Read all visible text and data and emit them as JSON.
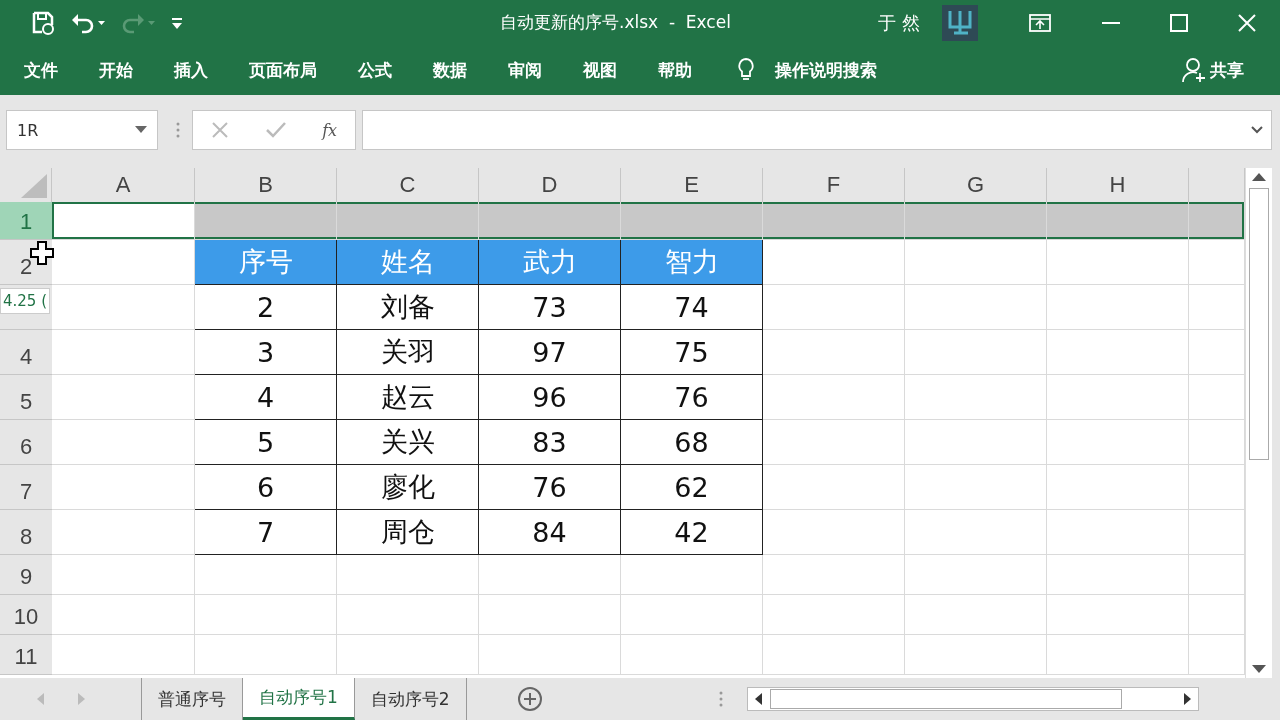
{
  "window": {
    "title": "自动更新的序号.xlsx  -  Excel",
    "user": "于 然"
  },
  "ribbon_tabs": [
    {
      "label": "文件"
    },
    {
      "label": "开始"
    },
    {
      "label": "插入"
    },
    {
      "label": "页面布局"
    },
    {
      "label": "公式"
    },
    {
      "label": "数据"
    },
    {
      "label": "审阅"
    },
    {
      "label": "视图"
    },
    {
      "label": "帮助"
    }
  ],
  "tell_me": "操作说明搜索",
  "share": "共享",
  "formula_bar": {
    "name_box": "1R",
    "function_label": "fx"
  },
  "columns": [
    "A",
    "B",
    "C",
    "D",
    "E",
    "F",
    "G",
    "H"
  ],
  "rows": [
    {
      "label": "1",
      "selected": true
    },
    {
      "label": "2",
      "selected": false
    },
    {
      "selected": false
    },
    {
      "label": "4",
      "selected": false
    },
    {
      "label": "5",
      "selected": false
    },
    {
      "label": "6",
      "selected": false
    },
    {
      "label": "7",
      "selected": false
    },
    {
      "label": "8",
      "selected": false
    },
    {
      "label": "9",
      "selected": false
    },
    {
      "label": "10",
      "selected": false
    },
    {
      "label": "11",
      "selected": false
    }
  ],
  "table": {
    "header": [
      "序号",
      "姓名",
      "武力",
      "智力"
    ],
    "rows": [
      [
        "2",
        "刘备",
        "73",
        "74"
      ],
      [
        "3",
        "关羽",
        "97",
        "75"
      ],
      [
        "4",
        "赵云",
        "96",
        "76"
      ],
      [
        "5",
        "关兴",
        "83",
        "68"
      ],
      [
        "6",
        "廖化",
        "76",
        "62"
      ],
      [
        "7",
        "周仓",
        "84",
        "42"
      ]
    ]
  },
  "row_height_tip": "4.25 (",
  "sheet_tabs": [
    {
      "label": "普通序号",
      "selected": false
    },
    {
      "label": "自动序号1",
      "selected": true
    },
    {
      "label": "自动序号2",
      "selected": false
    }
  ]
}
